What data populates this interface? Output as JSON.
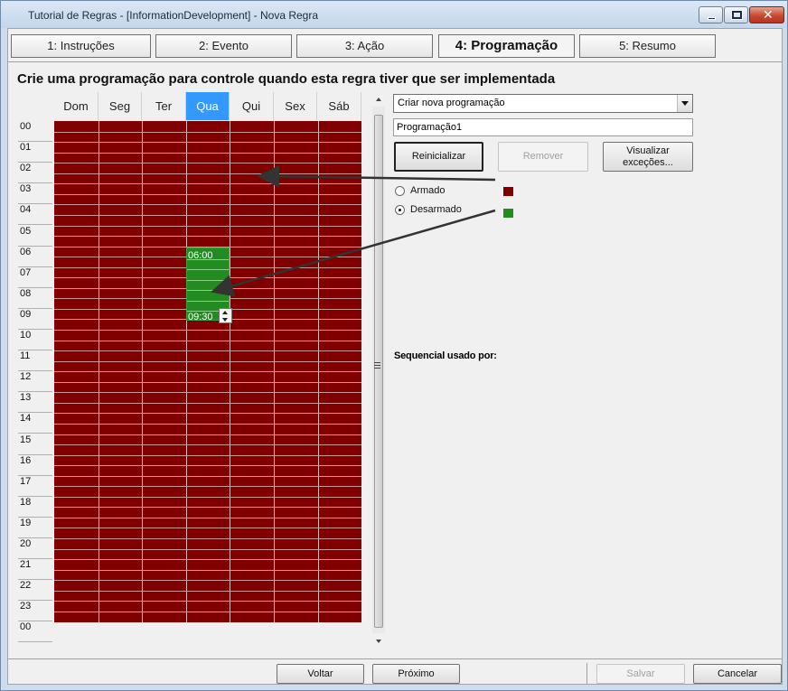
{
  "window": {
    "title": "Tutorial de Regras - [InformationDevelopment] - Nova Regra"
  },
  "tabs": [
    {
      "label": "1: Instruções"
    },
    {
      "label": "2: Evento"
    },
    {
      "label": "3: Ação"
    },
    {
      "label": "4: Programação",
      "active": true
    },
    {
      "label": "5: Resumo"
    }
  ],
  "heading": "Crie uma programação para controle quando esta regra tiver que ser implementada",
  "schedule": {
    "days": [
      "Dom",
      "Seg",
      "Ter",
      "Qua",
      "Qui",
      "Sex",
      "Sáb"
    ],
    "selected_day": "Qua",
    "hours": [
      "00",
      "01",
      "02",
      "03",
      "04",
      "05",
      "06",
      "07",
      "08",
      "09",
      "10",
      "11",
      "12",
      "13",
      "14",
      "15",
      "16",
      "17",
      "18",
      "19",
      "20",
      "21",
      "22",
      "23",
      "00"
    ],
    "block_start": "06:00",
    "block_end": "09:30",
    "armed_color": "#800000",
    "disarmed_color": "#228b22"
  },
  "right_panel": {
    "schedule_select": "Criar nova programação",
    "schedule_name": "Programação1",
    "reset_button": "Reinicializar",
    "remove_button": "Remover",
    "view_exceptions_line1": "Visualizar",
    "view_exceptions_line2": "exceções...",
    "armed_label": "Armado",
    "disarmed_label": "Desarmado",
    "disarmed_selected": true,
    "sequence_label": "Sequencial usado por:"
  },
  "footer": {
    "back": "Voltar",
    "next": "Próximo",
    "save": "Salvar",
    "cancel": "Cancelar"
  }
}
